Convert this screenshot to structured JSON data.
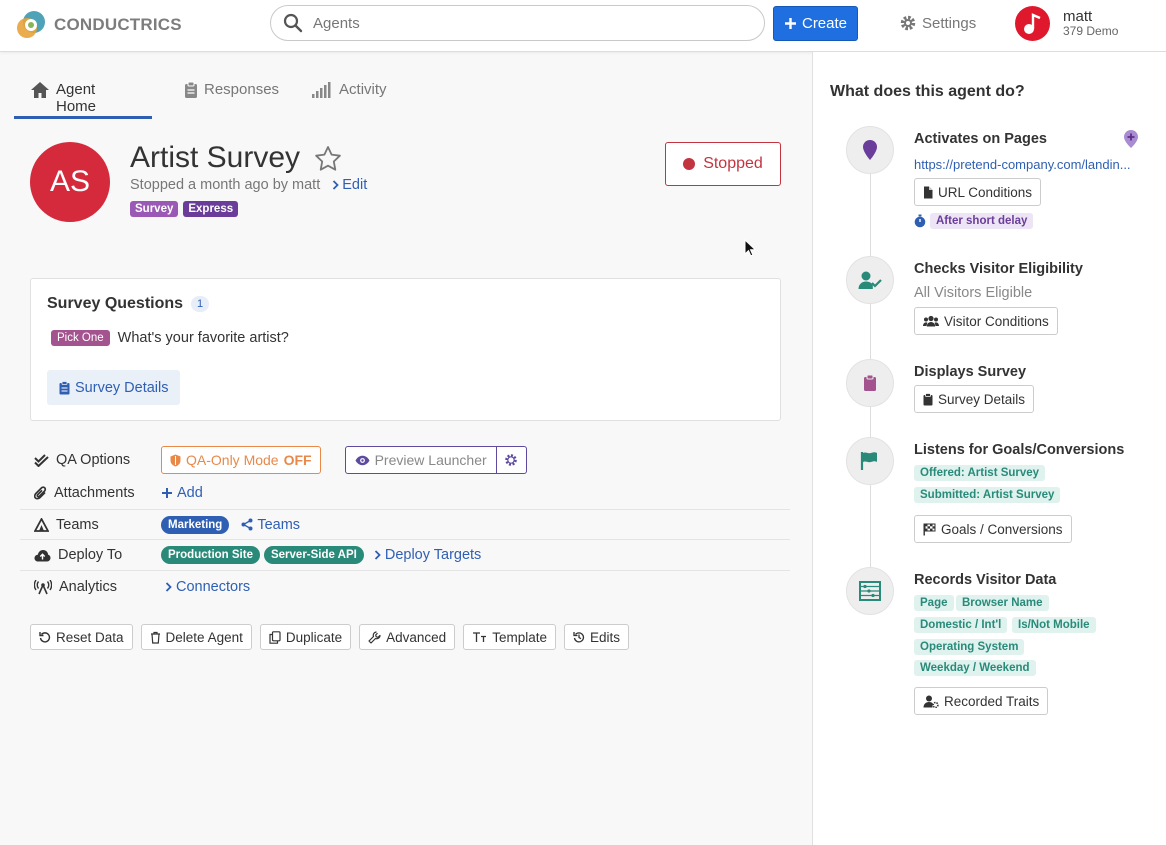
{
  "header": {
    "logo_text": "CONDUCTRICS",
    "search_placeholder": "Agents",
    "create_label": "Create",
    "settings_label": "Settings",
    "user_name": "matt",
    "user_sub": "379 Demo"
  },
  "tabs": [
    {
      "label": "Agent Home",
      "icon": "home-icon",
      "active": true
    },
    {
      "label": "Responses",
      "icon": "clipboard-icon",
      "active": false
    },
    {
      "label": "Activity",
      "icon": "signal-icon",
      "active": false
    }
  ],
  "agent": {
    "initials": "AS",
    "name": "Artist Survey",
    "status_line": "Stopped a month ago by matt",
    "edit_label": "Edit",
    "tags": [
      "Survey",
      "Express"
    ],
    "status_button": "Stopped"
  },
  "survey_card": {
    "title": "Survey Questions",
    "count": "1",
    "question_type": "Pick One",
    "question_text": "What's your favorite artist?",
    "details_button": "Survey Details"
  },
  "options": {
    "qa": {
      "label": "QA Options",
      "mode_label": "QA-Only Mode",
      "mode_value": "OFF",
      "preview_label": "Preview Launcher"
    },
    "attachments": {
      "label": "Attachments",
      "add_label": "Add"
    },
    "teams": {
      "label": "Teams",
      "chip": "Marketing",
      "link": "Teams"
    },
    "deploy": {
      "label": "Deploy To",
      "chips": [
        "Production Site",
        "Server-Side API"
      ],
      "link": "Deploy Targets"
    },
    "analytics": {
      "label": "Analytics",
      "link": "Connectors"
    }
  },
  "actions": [
    "Reset Data",
    "Delete Agent",
    "Duplicate",
    "Advanced",
    "Template",
    "Edits"
  ],
  "side": {
    "title": "What does this agent do?",
    "steps": {
      "pages": {
        "title": "Activates on Pages",
        "url": "https://pretend-company.com/landin...",
        "button": "URL Conditions",
        "timing": "After short delay"
      },
      "eligibility": {
        "title": "Checks Visitor Eligibility",
        "sub": "All Visitors Eligible",
        "button": "Visitor Conditions"
      },
      "displays": {
        "title": "Displays Survey",
        "button": "Survey Details"
      },
      "goals": {
        "title": "Listens for Goals/Conversions",
        "tags": [
          "Offered: Artist Survey",
          "Submitted: Artist Survey"
        ],
        "button": "Goals / Conversions"
      },
      "records": {
        "title": "Records Visitor Data",
        "tags": [
          "Page",
          "Browser Name",
          "Domestic / Int'l",
          "Is/Not Mobile",
          "Operating System",
          "Weekday / Weekend"
        ],
        "button": "Recorded Traits"
      }
    }
  },
  "colors": {
    "primary": "#1f6fe0",
    "link": "#2f5fb3",
    "danger": "#c2343f",
    "avatar": "#d42a3c",
    "teal": "#2a8a7a",
    "purple": "#6a3d9a"
  }
}
